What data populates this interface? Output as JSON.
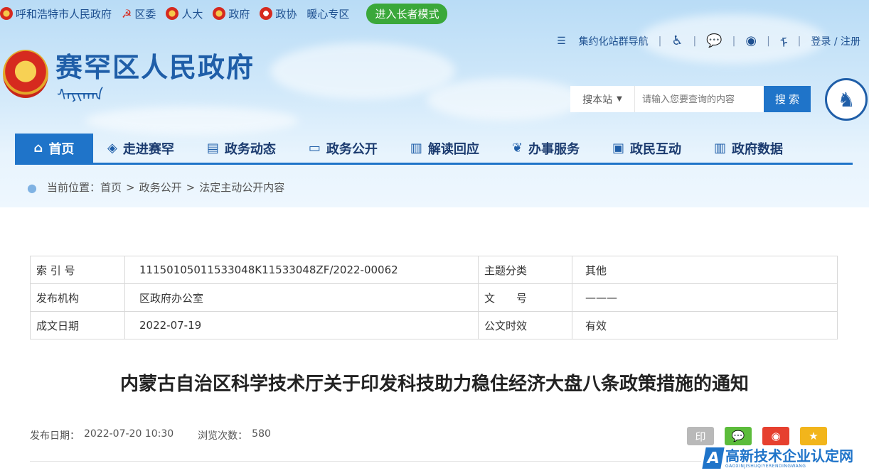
{
  "topbar": {
    "links": [
      "呼和浩特市人民政府",
      "区委",
      "人大",
      "政府",
      "政协",
      "暖心专区"
    ],
    "elder_mode": "进入长者模式"
  },
  "util": {
    "site_nav": "集约化站群导航",
    "login": "登录 / 注册",
    "separator": "|"
  },
  "header": {
    "site_title": "赛罕区人民政府",
    "mongolian": "ᠰᠠᠶᠢᠬᠠᠨ"
  },
  "search": {
    "scope": "搜本站",
    "placeholder": "请输入您要查询的内容",
    "button": "搜 索"
  },
  "nav": {
    "items": [
      "首页",
      "走进赛罕",
      "政务动态",
      "政务公开",
      "解读回应",
      "办事服务",
      "政民互动",
      "政府数据"
    ]
  },
  "breadcrumb": {
    "prefix": "当前位置：",
    "items": [
      "首页",
      "政务公开",
      "法定主动公开内容"
    ],
    "sep": ">"
  },
  "meta": {
    "rows": [
      {
        "k1": "索 引 号",
        "v1": "11150105011533048K11533048ZF/2022-00062",
        "k2": "主题分类",
        "v2": "其他"
      },
      {
        "k1": "发布机构",
        "v1": "区政府办公室",
        "k2": "文　　号",
        "v2": "———"
      },
      {
        "k1": "成文日期",
        "v1": "2022-07-19",
        "k2": "公文时效",
        "v2": "有效"
      }
    ]
  },
  "article": {
    "title": "内蒙古自治区科学技术厅关于印发科技助力稳住经济大盘八条政策措施的通知",
    "publish_label": "发布日期：",
    "publish_date": "2022-07-20 10:30",
    "views_label": "浏览次数：",
    "views": "580"
  },
  "share": {
    "print": "印"
  },
  "watermark": {
    "title": "高新技术企业认定网",
    "sub": "GAOXINJISHUQIYERENDINGWANG"
  }
}
